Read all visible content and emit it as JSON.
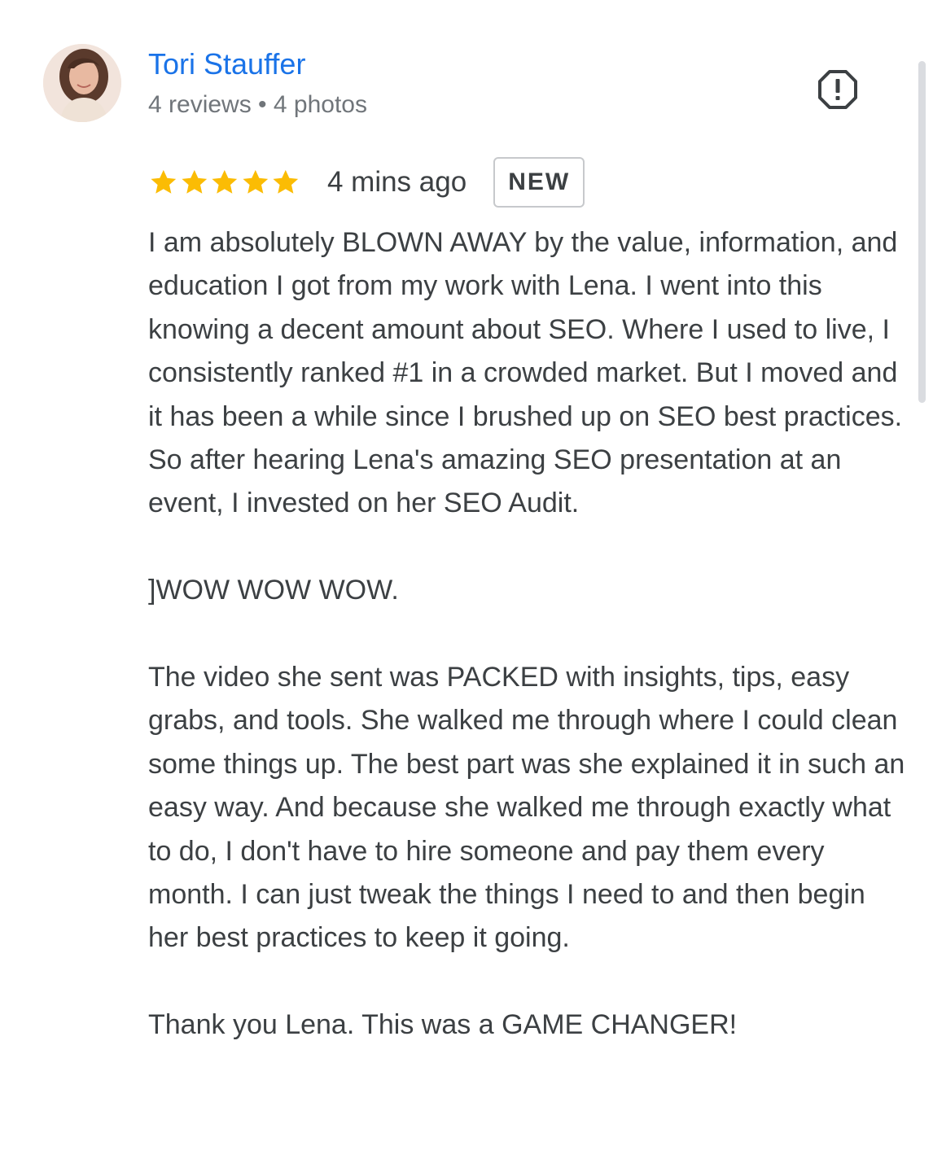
{
  "review": {
    "author": {
      "name": "Tori Stauffer",
      "meta": "4 reviews • 4 photos"
    },
    "rating": 5,
    "rating_max": 5,
    "time": "4 mins ago",
    "badge": "NEW",
    "paragraphs": [
      "I am absolutely BLOWN AWAY by the value, information, and education I got from my work with Lena. I went into this knowing a decent amount about SEO. Where I used to live, I consistently ranked #1 in a crowded market. But I moved and it has been a while since I brushed up on SEO best practices. So after hearing Lena's amazing SEO presentation at an event, I invested on her SEO Audit.",
      "]WOW WOW WOW.",
      "The video she sent was PACKED with insights, tips, easy grabs, and tools. She walked me through where I could clean some things up. The best part was she explained it in such an easy way. And because she walked me through exactly what to do, I don't have to hire someone and pay them every month. I can just tweak the things I need to and then begin her best practices to keep it going.",
      "Thank you Lena. This was a GAME CHANGER!"
    ]
  },
  "icons": {
    "avatar": "profile-photo",
    "report": "report-flag-icon",
    "star": "star-icon"
  },
  "colors": {
    "author_name": "#1a73e8",
    "star": "#fbbc04",
    "text": "#3c4043",
    "meta": "#70757a"
  }
}
